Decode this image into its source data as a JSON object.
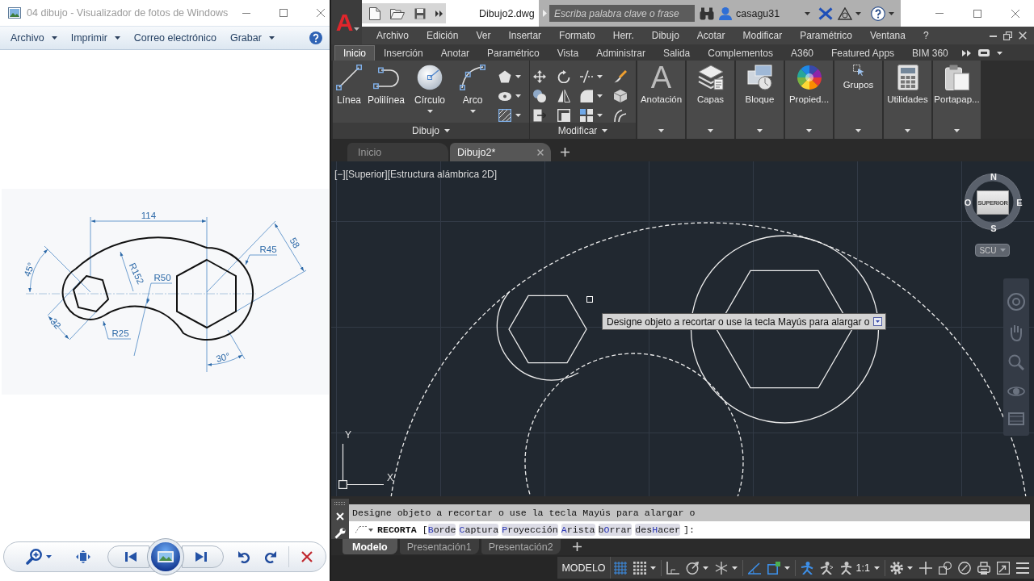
{
  "photo_viewer": {
    "title": "04 dibujo - Visualizador de fotos de Windows",
    "menu": [
      {
        "label": "Archivo",
        "dropdown": true
      },
      {
        "label": "Imprimir",
        "dropdown": true
      },
      {
        "label": "Correo electrónico",
        "dropdown": false
      },
      {
        "label": "Grabar",
        "dropdown": true
      }
    ],
    "image": {
      "dimensions": {
        "center_distance": "114",
        "top_arc_radius": "R152",
        "bottom_arc_radius": "R50",
        "right_end_radius": "R45",
        "right_hexagon_size": "58",
        "left_angle": "45°",
        "left_hexagon_size": "32",
        "left_end_radius": "R25",
        "right_angle": "30°"
      }
    }
  },
  "autocad": {
    "logo": "A",
    "file_name": "Dibujo2.dwg",
    "search": {
      "placeholder": "Escriba palabra clave o frase"
    },
    "user": "casagu31",
    "menu": [
      "Archivo",
      "Edición",
      "Ver",
      "Insertar",
      "Formato",
      "Herr.",
      "Dibujo",
      "Acotar",
      "Modificar",
      "Paramétrico",
      "Ventana",
      "?"
    ],
    "ribbon_tabs": [
      {
        "label": "Inicio",
        "selected": true
      },
      {
        "label": "Inserción",
        "selected": false
      },
      {
        "label": "Anotar",
        "selected": false
      },
      {
        "label": "Paramétrico",
        "selected": false
      },
      {
        "label": "Vista",
        "selected": false
      },
      {
        "label": "Administrar",
        "selected": false
      },
      {
        "label": "Salida",
        "selected": false
      },
      {
        "label": "Complementos",
        "selected": false
      },
      {
        "label": "A360",
        "selected": false
      },
      {
        "label": "Featured Apps",
        "selected": false
      },
      {
        "label": "BIM 360",
        "selected": false
      }
    ],
    "ribbon_panels": [
      {
        "title": "Dibujo",
        "large_tools": [
          {
            "kind": "line",
            "label": "Línea",
            "dropdown": false
          },
          {
            "kind": "polyline",
            "label": "Polilínea",
            "dropdown": false
          },
          {
            "kind": "circle",
            "label": "Círculo",
            "dropdown": true
          },
          {
            "kind": "arc",
            "label": "Arco",
            "dropdown": true
          }
        ],
        "small_tools": [
          {
            "kind": "polygon",
            "dropdown": true
          },
          {
            "kind": "ellipse",
            "dropdown": true
          },
          {
            "kind": "hatch",
            "dropdown": true
          }
        ]
      },
      {
        "title": "Modificar",
        "small_tools": [
          {
            "kind": "move",
            "dropdown": false
          },
          {
            "kind": "rotate",
            "dropdown": false
          },
          {
            "kind": "trim",
            "dropdown": true
          },
          {
            "kind": "brush",
            "dropdown": false
          },
          {
            "kind": "copy",
            "dropdown": false
          },
          {
            "kind": "mirror",
            "dropdown": false
          },
          {
            "kind": "fillet",
            "dropdown": true
          },
          {
            "kind": "explode",
            "dropdown": false
          },
          {
            "kind": "stretch",
            "dropdown": false
          },
          {
            "kind": "scale",
            "dropdown": false
          },
          {
            "kind": "array",
            "dropdown": true
          },
          {
            "kind": "offset",
            "dropdown": false
          }
        ]
      }
    ],
    "collapsed_panels": [
      {
        "kind": "annotation",
        "label": "Anotación",
        "glyph": "A"
      },
      {
        "kind": "layers",
        "label": "Capas"
      },
      {
        "kind": "block",
        "label": "Bloque"
      },
      {
        "kind": "properties",
        "label": "Propied..."
      },
      {
        "kind": "groups",
        "label": "Grupos"
      },
      {
        "kind": "utilities",
        "label": "Utilidades"
      },
      {
        "kind": "clipboard",
        "label": "Portapap..."
      }
    ],
    "file_tabs": [
      {
        "label": "Inicio",
        "selected": false,
        "closable": false
      },
      {
        "label": "Dibujo2*",
        "selected": true,
        "closable": true
      }
    ],
    "viewport_label": "[−][Superior][Estructura alámbrica 2D]",
    "viewcube": {
      "face": "SUPERIOR",
      "north": "N",
      "east": "E",
      "south": "S",
      "west": "O",
      "ucs_menu": "SCU"
    },
    "tooltip": "Designe objeto a recortar o use la tecla Mayús para alargar o",
    "ucs_icon": {
      "x_label": "X",
      "y_label": "Y"
    },
    "command_history": "Designe objeto a recortar o use la tecla Mayús para alargar o",
    "command": {
      "name": "RECORTA",
      "open": "[",
      "options": [
        {
          "key": "B",
          "after": "orde"
        },
        {
          "key": "C",
          "after": "aptura"
        },
        {
          "key": "P",
          "after": "royección"
        },
        {
          "key": "A",
          "after": "rista"
        },
        {
          "before": "b",
          "key": "O",
          "after": "rrar"
        },
        {
          "before": "des",
          "key": "H",
          "after": "acer"
        }
      ],
      "close": "]:"
    },
    "layout_tabs": [
      {
        "label": "Modelo",
        "selected": true
      },
      {
        "label": "Presentación1",
        "selected": false
      },
      {
        "label": "Presentación2",
        "selected": false
      }
    ],
    "status_bar": {
      "space": "MODELO",
      "toggles": [
        {
          "kind": "grid",
          "on": true,
          "dropdown": false
        },
        {
          "kind": "snap",
          "on": false,
          "dropdown": true
        },
        {
          "kind": "ortho",
          "on": false,
          "dropdown": false
        },
        {
          "kind": "polar",
          "on": false,
          "dropdown": true
        },
        {
          "kind": "isodraft",
          "on": false,
          "dropdown": true
        },
        {
          "kind": "tracking",
          "on": true,
          "dropdown": false
        },
        {
          "kind": "osnap",
          "on": true,
          "dropdown": true
        },
        {
          "kind": "annotation_visibility",
          "on": true,
          "dropdown": false
        },
        {
          "kind": "autoscale",
          "on": false,
          "dropdown": false
        }
      ],
      "scale": "1:1",
      "tools": [
        {
          "kind": "workspace",
          "dropdown": true
        },
        {
          "kind": "plus",
          "dropdown": false
        },
        {
          "kind": "units",
          "dropdown": false
        },
        {
          "kind": "isolate",
          "dropdown": false
        },
        {
          "kind": "hardware",
          "dropdown": false
        },
        {
          "kind": "clean_screen",
          "dropdown": false
        },
        {
          "kind": "customize",
          "dropdown": false
        }
      ]
    }
  }
}
